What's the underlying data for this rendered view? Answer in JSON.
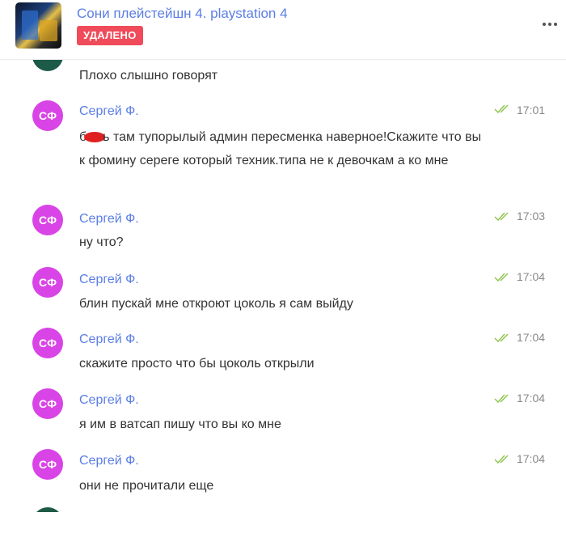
{
  "header": {
    "title": "Сони плейстейшн 4. playstation 4",
    "status_badge": "УДАЛЕНО",
    "more_icon": "more-horizontal-icon"
  },
  "messages": [
    {
      "avatar": "",
      "sender": "",
      "text": "Плохо слышно говорят",
      "time": ""
    },
    {
      "avatar": "СФ",
      "sender": "Сергей Ф.",
      "text_before_censor": "б",
      "text": "ь там тупорылый админ пересменка наверное!Скажите что вы к фомину сереге который техник.типа не к девочкам а ко мне",
      "time": "17:01"
    },
    {
      "avatar": "СФ",
      "sender": "Сергей Ф.",
      "text": "ну что?",
      "time": "17:03"
    },
    {
      "avatar": "СФ",
      "sender": "Сергей Ф.",
      "text": "блин пускай мне откроют цоколь я сам выйду",
      "time": "17:04"
    },
    {
      "avatar": "СФ",
      "sender": "Сергей Ф.",
      "text": "скажите просто что бы цоколь открыли",
      "time": "17:04"
    },
    {
      "avatar": "СФ",
      "sender": "Сергей Ф.",
      "text": "я им в ватсап пишу что вы ко мне",
      "time": "17:04"
    },
    {
      "avatar": "СФ",
      "sender": "Сергей Ф.",
      "text": "они не прочитали еще",
      "time": "17:04"
    }
  ],
  "colors": {
    "accent": "#5b7ee5",
    "badge": "#f04b5a",
    "avatar": "#d944e6",
    "read_check": "#8bc34a"
  }
}
